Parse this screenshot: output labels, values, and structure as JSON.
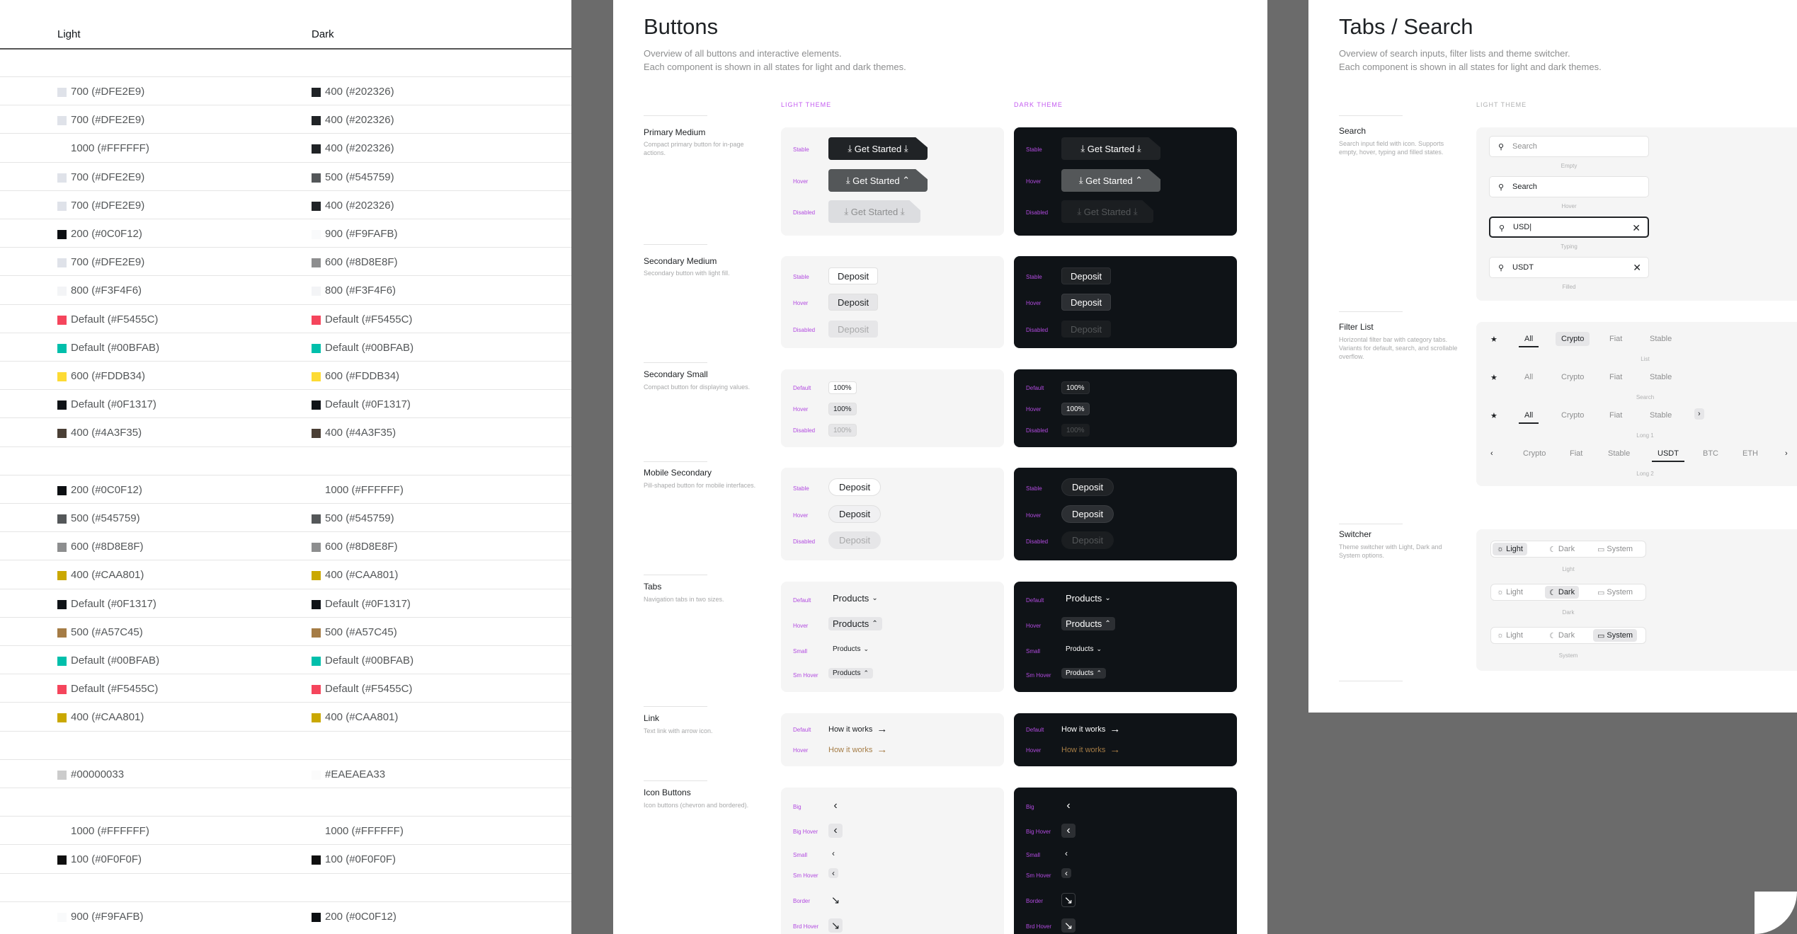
{
  "left_panel": {
    "header": {
      "light": "Light",
      "dark": "Dark"
    },
    "rows": [
      {
        "light": {
          "label": "700 (#DFE2E9)",
          "color": "#DFE2E9"
        },
        "dark": {
          "label": "400 (#202326)",
          "color": "#202326"
        }
      },
      {
        "light": {
          "label": "700 (#DFE2E9)",
          "color": "#DFE2E9"
        },
        "dark": {
          "label": "400 (#202326)",
          "color": "#202326"
        }
      },
      {
        "light": {
          "label": "1000 (#FFFFFF)",
          "color": "#FFFFFF"
        },
        "dark": {
          "label": "400 (#202326)",
          "color": "#202326"
        }
      },
      {
        "light": {
          "label": "700 (#DFE2E9)",
          "color": "#DFE2E9"
        },
        "dark": {
          "label": "500 (#545759)",
          "color": "#545759"
        }
      },
      {
        "light": {
          "label": "700 (#DFE2E9)",
          "color": "#DFE2E9"
        },
        "dark": {
          "label": "400 (#202326)",
          "color": "#202326"
        }
      },
      {
        "light": {
          "label": "200 (#0C0F12)",
          "color": "#0C0F12"
        },
        "dark": {
          "label": "900 (#F9FAFB)",
          "color": "#F9FAFB"
        }
      },
      {
        "light": {
          "label": "700 (#DFE2E9)",
          "color": "#DFE2E9"
        },
        "dark": {
          "label": "600 (#8D8E8F)",
          "color": "#8D8E8F"
        }
      },
      {
        "light": {
          "label": "800 (#F3F4F6)",
          "color": "#F3F4F6"
        },
        "dark": {
          "label": "800 (#F3F4F6)",
          "color": "#F3F4F6"
        }
      },
      {
        "light": {
          "label": "Default (#F5455C)",
          "color": "#F5455C"
        },
        "dark": {
          "label": "Default (#F5455C)",
          "color": "#F5455C"
        }
      },
      {
        "light": {
          "label": "Default (#00BFAB)",
          "color": "#00BFAB"
        },
        "dark": {
          "label": "Default (#00BFAB)",
          "color": "#00BFAB"
        }
      },
      {
        "light": {
          "label": "600 (#FDDB34)",
          "color": "#FDDB34"
        },
        "dark": {
          "label": "600 (#FDDB34)",
          "color": "#FDDB34"
        }
      },
      {
        "light": {
          "label": "Default (#0F1317)",
          "color": "#0F1317"
        },
        "dark": {
          "label": "Default (#0F1317)",
          "color": "#0F1317"
        }
      },
      {
        "light": {
          "label": "400 (#4A3F35)",
          "color": "#4A3F35"
        },
        "dark": {
          "label": "400 (#4A3F35)",
          "color": "#4A3F35"
        }
      },
      {
        "light": {
          "label": "",
          "color": ""
        },
        "dark": {
          "label": "",
          "color": ""
        }
      },
      {
        "light": {
          "label": "200 (#0C0F12)",
          "color": "#0C0F12"
        },
        "dark": {
          "label": "1000 (#FFFFFF)",
          "color": "#FFFFFF"
        }
      },
      {
        "light": {
          "label": "500 (#545759)",
          "color": "#545759"
        },
        "dark": {
          "label": "500 (#545759)",
          "color": "#545759"
        }
      },
      {
        "light": {
          "label": "600 (#8D8E8F)",
          "color": "#8D8E8F"
        },
        "dark": {
          "label": "600 (#8D8E8F)",
          "color": "#8D8E8F"
        }
      },
      {
        "light": {
          "label": "400 (#CAA801)",
          "color": "#CAA801"
        },
        "dark": {
          "label": "400 (#CAA801)",
          "color": "#CAA801"
        }
      },
      {
        "light": {
          "label": "Default (#0F1317)",
          "color": "#0F1317"
        },
        "dark": {
          "label": "Default (#0F1317)",
          "color": "#0F1317"
        }
      },
      {
        "light": {
          "label": "500 (#A57C45)",
          "color": "#A57C45"
        },
        "dark": {
          "label": "500 (#A57C45)",
          "color": "#A57C45"
        }
      },
      {
        "light": {
          "label": "Default (#00BFAB)",
          "color": "#00BFAB"
        },
        "dark": {
          "label": "Default (#00BFAB)",
          "color": "#00BFAB"
        }
      },
      {
        "light": {
          "label": "Default (#F5455C)",
          "color": "#F5455C"
        },
        "dark": {
          "label": "Default (#F5455C)",
          "color": "#F5455C"
        }
      },
      {
        "light": {
          "label": "400 (#CAA801)",
          "color": "#CAA801"
        },
        "dark": {
          "label": "400 (#CAA801)",
          "color": "#CAA801"
        }
      },
      {
        "light": {
          "label": "",
          "color": ""
        },
        "dark": {
          "label": "",
          "color": ""
        }
      },
      {
        "light": {
          "label": "#00000033",
          "color": "#00000033"
        },
        "dark": {
          "label": "#EAEAEA33",
          "color": "#EAEAEA33"
        }
      },
      {
        "light": {
          "label": "",
          "color": ""
        },
        "dark": {
          "label": "",
          "color": ""
        }
      },
      {
        "light": {
          "label": "1000 (#FFFFFF)",
          "color": "#FFFFFF"
        },
        "dark": {
          "label": "1000 (#FFFFFF)",
          "color": "#FFFFFF"
        }
      },
      {
        "light": {
          "label": "100 (#0F0F0F)",
          "color": "#0F0F0F"
        },
        "dark": {
          "label": "100 (#0F0F0F)",
          "color": "#0F0F0F"
        }
      },
      {
        "light": {
          "label": "",
          "color": ""
        },
        "dark": {
          "label": "",
          "color": ""
        }
      },
      {
        "light": {
          "label": "900 (#F9FAFB)",
          "color": "#F9FAFB"
        },
        "dark": {
          "label": "200 (#0C0F12)",
          "color": "#0C0F12"
        }
      }
    ]
  },
  "buttons_page": {
    "title": "Buttons",
    "desc1": "Overview of all buttons and interactive elements.",
    "desc2": "Each component is shown in all states for light and dark themes.",
    "light_theme": "LIGHT THEME",
    "dark_theme": "DARK THEME",
    "primary": {
      "title": "Primary Medium",
      "desc": "Compact primary button for in-page actions.",
      "states": [
        "Stable",
        "Hover",
        "Disabled"
      ],
      "label": "Get Started"
    },
    "secondary": {
      "title": "Secondary Medium",
      "desc": "Secondary button with light fill.",
      "states": [
        "Stable",
        "Hover",
        "Disabled"
      ],
      "label": "Deposit"
    },
    "secondary_small": {
      "title": "Secondary Small",
      "desc": "Compact button for displaying values.",
      "states": [
        "Default",
        "Hover",
        "Disabled"
      ],
      "label": "100%"
    },
    "mobile": {
      "title": "Mobile Secondary",
      "desc": "Pill-shaped button for mobile interfaces.",
      "states": [
        "Stable",
        "Hover",
        "Disabled"
      ],
      "label": "Deposit"
    },
    "tabs": {
      "title": "Tabs",
      "desc": "Navigation tabs in two sizes.",
      "states": [
        "Default",
        "Hover",
        "Small",
        "Sm Hover"
      ],
      "label": "Products"
    },
    "link": {
      "title": "Link",
      "desc": "Text link with arrow icon.",
      "states": [
        "Default",
        "Hover"
      ],
      "label": "How it works",
      "hover_color": "#A57C45"
    },
    "icon_buttons": {
      "title": "Icon Buttons",
      "desc": "Icon buttons (chevron and bordered).",
      "states": [
        "Big",
        "Big Hover",
        "Small",
        "Sm Hover",
        "Border",
        "Brd Hover"
      ]
    }
  },
  "tabs_page": {
    "title": "Tabs / Search",
    "desc1": "Overview of search inputs, filter lists and theme switcher.",
    "desc2": "Each component is shown in all states for light and dark themes.",
    "light_theme": "LIGHT THEME",
    "search": {
      "title": "Search",
      "desc": "Search input field with icon. Supports empty, hover, typing and filled states.",
      "inputs": [
        {
          "value": "",
          "placeholder": "Search",
          "caption": "Empty"
        },
        {
          "value": "",
          "placeholder": "Search",
          "caption": "Hover"
        },
        {
          "value": "USD|",
          "placeholder": "",
          "caption": "Typing"
        },
        {
          "value": "USDT",
          "placeholder": "",
          "caption": "Filled"
        }
      ]
    },
    "filter": {
      "title": "Filter List",
      "desc": "Horizontal filter bar with category tabs. Variants for default, search, and scrollable overflow.",
      "rows": [
        {
          "items": [
            "All",
            "Crypto",
            "Fiat",
            "Stable"
          ],
          "caption": "List"
        },
        {
          "items": [
            "All",
            "Crypto",
            "Fiat",
            "Stable"
          ],
          "caption": "Search"
        },
        {
          "items": [
            "All",
            "Crypto",
            "Fiat",
            "Stable"
          ],
          "caption": "Long 1"
        },
        {
          "items": [
            "Crypto",
            "Fiat",
            "Stable",
            "USDT",
            "BTC",
            "ETH"
          ],
          "caption": "Long 2"
        }
      ]
    },
    "switcher": {
      "title": "Switcher",
      "desc": "Theme switcher with Light, Dark and System options.",
      "options": [
        "Light",
        "Dark",
        "System"
      ],
      "captions": [
        "Light",
        "Dark",
        "System"
      ]
    }
  },
  "colors": {
    "accent_purple": "#c45cf0",
    "dark_bg": "#0F1317",
    "canvas": "#6b6b6b"
  }
}
